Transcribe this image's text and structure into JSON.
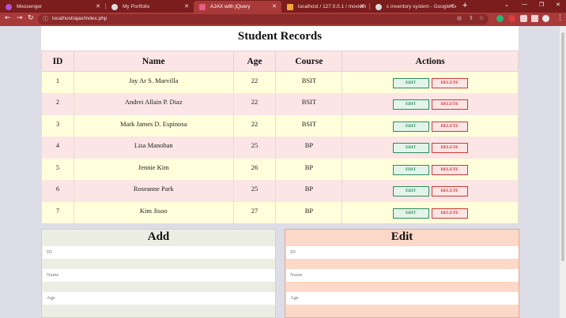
{
  "browser": {
    "tabs": [
      {
        "label": "Messenger",
        "color": "#b34fd6"
      },
      {
        "label": "My Portfolio",
        "color": "#dddddd"
      },
      {
        "label": "AJAX with jQuery",
        "color": "#e85c85"
      },
      {
        "label": "localhost / 127.0.0.1 / moviethea",
        "color": "#f2a53a"
      },
      {
        "label": "c inventory system - Google Sea",
        "color": "#dddddd"
      }
    ],
    "url": "localhost/ajax/index.php"
  },
  "records": {
    "title": "Student Records",
    "columns": [
      "ID",
      "Name",
      "Age",
      "Course",
      "Actions"
    ],
    "rows": [
      {
        "id": "1",
        "name": "Jay Ar S. Marvilla",
        "age": "22",
        "course": "BSIT"
      },
      {
        "id": "2",
        "name": "Andrei Allain P. Diaz",
        "age": "22",
        "course": "BSIT"
      },
      {
        "id": "3",
        "name": "Mark James D. Espinosa",
        "age": "22",
        "course": "BSIT"
      },
      {
        "id": "4",
        "name": "Lisa Manoban",
        "age": "25",
        "course": "BP"
      },
      {
        "id": "5",
        "name": "Jennie Kim",
        "age": "26",
        "course": "BP"
      },
      {
        "id": "6",
        "name": "Roseanne Park",
        "age": "25",
        "course": "BP"
      },
      {
        "id": "7",
        "name": "Kim Jisoo",
        "age": "27",
        "course": "BP"
      }
    ],
    "edit_label": "EDIT",
    "delete_label": "DELETE"
  },
  "add_form": {
    "title": "Add",
    "id_placeholder": "ID",
    "name_placeholder": "Name",
    "age_placeholder": "Age"
  },
  "edit_form": {
    "title": "Edit",
    "id_placeholder": "ID",
    "name_placeholder": "Name",
    "age_placeholder": "Age"
  }
}
